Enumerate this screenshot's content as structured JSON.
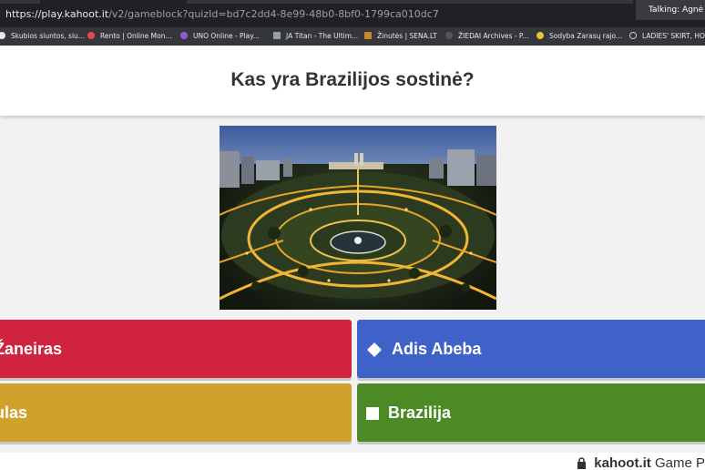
{
  "browser": {
    "url_host": "https://play.kahoot.it",
    "url_path": "/v2/gameblock?quizId=bd7c2dd4-8e99-48b0-8bf0-1799ca010dc7",
    "talking_label": "Talking: Agnė S"
  },
  "bookmarks": [
    {
      "label": "Skubios siuntos, siu...",
      "color": "#e8eaed"
    },
    {
      "label": "Rento | Online Mon...",
      "color": "#e84a4a"
    },
    {
      "label": "UNO Online - Play...",
      "color": "#8e5bd6"
    },
    {
      "label": "JA Titan - The Ultim...",
      "color": "#9aa0a6"
    },
    {
      "label": "Žinutės | SENA.LT",
      "color": "#c7872e"
    },
    {
      "label": "ŽIEDAI Archives - P...",
      "color": "#444"
    },
    {
      "label": "Sodyba Zarasų rajo...",
      "color": "#e8c13a"
    },
    {
      "label": "LADIES' SKIRT, HO...",
      "color": "#cccccc"
    }
  ],
  "question": "Kas yra Brazilijos sostinė?",
  "answers": {
    "a1": "Žaneiras",
    "a2": "Adis Abeba",
    "a3": "ulas",
    "a4": "Brazilija"
  },
  "footer": {
    "brand": "kahoot.it",
    "suffix": "Game P"
  },
  "colors": {
    "red": "#cf2340",
    "blue": "#3f62c9",
    "yellow": "#d1a22b",
    "green": "#4b8a24"
  }
}
